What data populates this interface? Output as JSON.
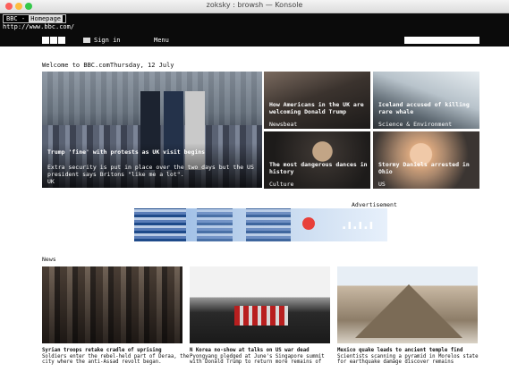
{
  "window": {
    "title": "zoksky : browsh — Konsole"
  },
  "terminal": {
    "tab_prefix": "BBC - ",
    "tab_page": "Homepage",
    "url": "http://www.bbc.com/"
  },
  "nav": {
    "sign_in": "Sign in",
    "menu": "Menu"
  },
  "welcome": {
    "text": "Welcome to BBC.com",
    "date": "Thursday, 12 July"
  },
  "stories": [
    {
      "title": "Trump 'fine' with protests as UK visit begins",
      "summary": "Extra security is put in place over the two days but the US president says Britons \"like me a lot\".",
      "tag": "UK"
    },
    {
      "title": "How Americans in the UK are welcoming Donald Trump",
      "tag": "Newsbeat"
    },
    {
      "title": "Iceland accused of killing rare whale",
      "tag": "Science & Environment"
    },
    {
      "title": "The most dangerous dances in history",
      "tag": "Culture"
    },
    {
      "title": "Stormy Daniels arrested in Ohio",
      "tag": "US"
    }
  ],
  "ad": {
    "label": "Advertisement"
  },
  "news": {
    "label": "News",
    "items": [
      {
        "headline": "Syrian troops retake cradle of uprising",
        "summary": "Soldiers enter the rebel-held part of Deraa, the city where the anti-Assad revolt began."
      },
      {
        "headline": "N Korea no-show at talks on US war dead",
        "summary": "Pyongyang pledged at June's Singapore summit with Donald Trump to return more remains of"
      },
      {
        "headline": "Mexico quake leads to ancient temple find",
        "summary": "Scientists scanning a pyramid in Morelos state for earthquake damage discover remains"
      }
    ]
  }
}
